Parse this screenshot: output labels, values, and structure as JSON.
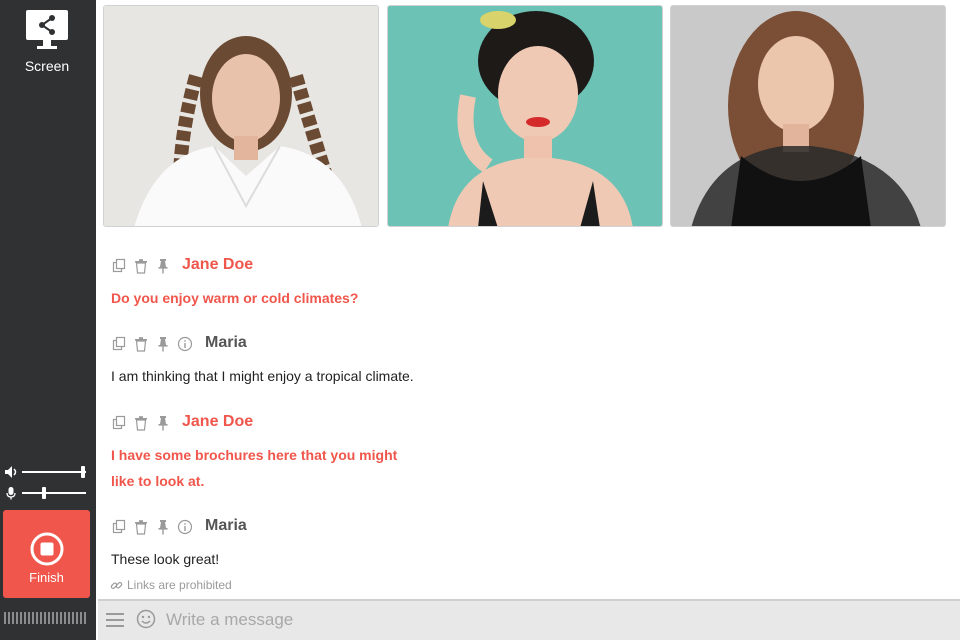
{
  "sidebar": {
    "screen_label": "Screen",
    "finish_label": "Finish",
    "volume_level": 0.95,
    "mic_level": 0.35
  },
  "participants": [
    {
      "tile": "participant-1",
      "background": "#e8e6e2"
    },
    {
      "tile": "participant-2",
      "background": "#6cc2b4"
    },
    {
      "tile": "participant-3",
      "background": "#c9c9c9"
    }
  ],
  "messages": [
    {
      "sender": "Jane Doe",
      "text": "Do you enjoy warm or cold climates?"
    },
    {
      "sender": "Maria",
      "text": "I am thinking that I might enjoy a tropical climate."
    },
    {
      "sender": "Jane Doe",
      "text_line1": "I have some brochures here that you might",
      "text_line2": "like to look at."
    },
    {
      "sender": "Maria",
      "text": "These look great!"
    }
  ],
  "links_note": "Links are prohibited",
  "composer": {
    "placeholder": "Write a message"
  },
  "colors": {
    "accent": "#f0564b",
    "sidebar": "#2f3133"
  }
}
